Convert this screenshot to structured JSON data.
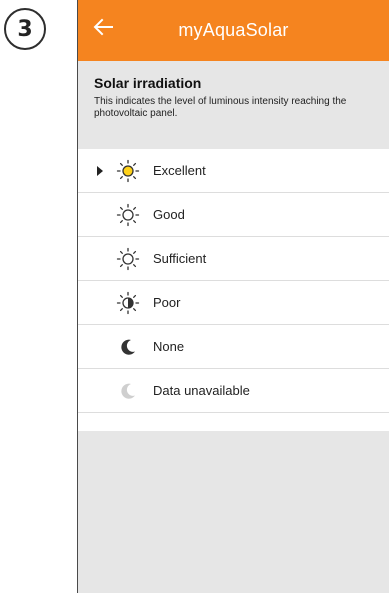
{
  "step": {
    "number": "3"
  },
  "app": {
    "title": "myAquaSolar",
    "accent_color": "#f5841f",
    "back_icon": "arrow-left-icon"
  },
  "info": {
    "title": "Solar irradiation",
    "description": "This indicates the level of luminous intensity reaching the photovoltaic panel."
  },
  "levels": [
    {
      "label": "Excellent",
      "icon": "sun-yellow-icon",
      "current": true
    },
    {
      "label": "Good",
      "icon": "sun-outline-icon",
      "current": false
    },
    {
      "label": "Sufficient",
      "icon": "sun-outline-icon",
      "current": false
    },
    {
      "label": "Poor",
      "icon": "sun-half-icon",
      "current": false
    },
    {
      "label": "None",
      "icon": "moon-icon",
      "current": false
    },
    {
      "label": "Data unavailable",
      "icon": "moon-grey-icon",
      "current": false
    }
  ]
}
